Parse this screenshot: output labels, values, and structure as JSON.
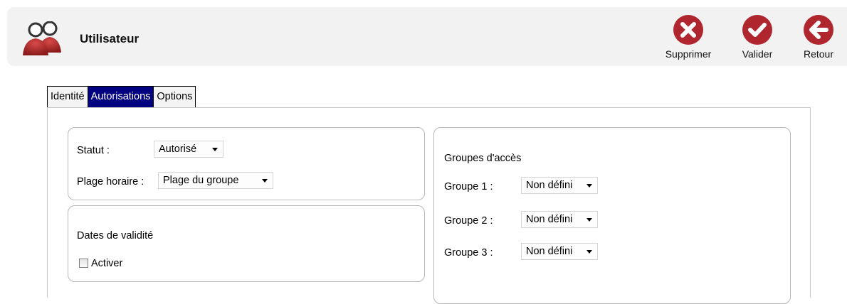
{
  "header": {
    "title": "Utilisateur",
    "actions": {
      "delete_label": "Supprimer",
      "validate_label": "Valider",
      "back_label": "Retour"
    },
    "icons": {
      "user": "users-icon",
      "delete": "x-circle-icon",
      "validate": "check-circle-icon",
      "back": "arrow-left-circle-icon"
    },
    "accent_color": "#b0262f"
  },
  "tabs": [
    {
      "label": "Identité",
      "active": false
    },
    {
      "label": "Autorisations",
      "active": true
    },
    {
      "label": "Options",
      "active": false
    }
  ],
  "status_panel": {
    "status_label": "Statut :",
    "status_value": "Autorisé",
    "timeslot_label": "Plage horaire :",
    "timeslot_value": "Plage du groupe"
  },
  "validity_panel": {
    "title": "Dates de validité",
    "enable_label": "Activer",
    "enable_checked": false
  },
  "groups_panel": {
    "title": "Groupes d'accès",
    "groups": [
      {
        "label": "Groupe 1 :",
        "value": "Non défini"
      },
      {
        "label": "Groupe 2 :",
        "value": "Non défini"
      },
      {
        "label": "Groupe 3 :",
        "value": "Non défini"
      }
    ]
  }
}
